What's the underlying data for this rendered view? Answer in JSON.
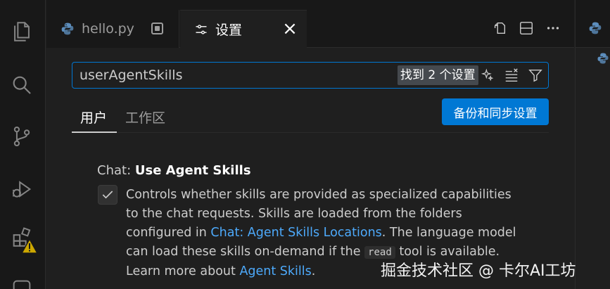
{
  "tabs": {
    "hello": {
      "label": "hello.py"
    },
    "settings": {
      "label": "设置"
    }
  },
  "search": {
    "value": "userAgentSkills",
    "result_count": "找到 2 个设置"
  },
  "scope": {
    "user": "用户",
    "workspace": "工作区"
  },
  "sync_button": "备份和同步设置",
  "setting": {
    "category": "Chat: ",
    "label": "Use Agent Skills",
    "checked": true,
    "desc_part1": "Controls whether skills are provided as specialized capabilities to the chat requests. Skills are loaded from the folders configured in ",
    "link1": "Chat: Agent Skills Locations",
    "desc_part2": ". The language model can load these skills on-demand if the ",
    "code": "read",
    "desc_part3": " tool is available. Learn more about ",
    "link2": "Agent Skills",
    "desc_part4": "."
  },
  "watermark": "掘金技术社区 @ 卡尔AI工坊",
  "colors": {
    "accent": "#0078d4",
    "link": "#4daafc",
    "warning": "#cca700"
  }
}
